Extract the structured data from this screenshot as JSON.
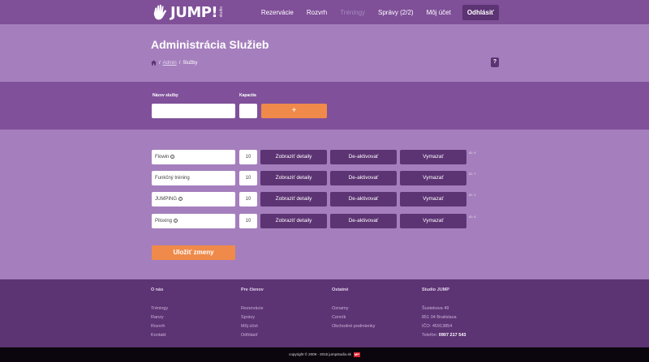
{
  "logo": {
    "text": "JUMP!",
    "sub": "studio"
  },
  "nav": {
    "items": [
      {
        "label": "Rezervácie",
        "active": false
      },
      {
        "label": "Rozvrh",
        "active": false
      },
      {
        "label": "Tréningy",
        "active": true
      },
      {
        "label": "Správy (2/2)",
        "active": false
      },
      {
        "label": "Môj účet",
        "active": false
      }
    ],
    "logout": "Odhlásiť"
  },
  "header": {
    "title": "Administrácia Služieb",
    "breadcrumb": {
      "sep": "/",
      "admin": "Admin",
      "current": "Služby"
    },
    "help": "?"
  },
  "new_service": {
    "name_label": "Názov služby",
    "capacity_label": "Kapacita",
    "add_label": "+"
  },
  "services": [
    {
      "name": "Flowin",
      "info": true,
      "capacity": "10",
      "details": "Zobraziť detaily",
      "deactivate": "De-aktivovať",
      "delete": "Vymazať",
      "id": "ID: 9"
    },
    {
      "name": "Funkčný tréning",
      "info": false,
      "capacity": "10",
      "details": "Zobraziť detaily",
      "deactivate": "De-aktivovať",
      "delete": "Vymazať",
      "id": "ID: 7"
    },
    {
      "name": "JUMPING",
      "info": true,
      "capacity": "10",
      "details": "Zobraziť detaily",
      "deactivate": "De-aktivovať",
      "delete": "Vymazať",
      "id": "ID: 1"
    },
    {
      "name": "Piloxing",
      "info": true,
      "capacity": "10",
      "details": "Zobraziť detaily",
      "deactivate": "De-aktivovať",
      "delete": "Vymazať",
      "id": "ID: 8"
    }
  ],
  "save_label": "Uložiť zmeny",
  "footer": {
    "col1": {
      "title": "O nás",
      "items": [
        "Tréningy",
        "Ranzy",
        "Rozvrh",
        "Kontakt"
      ]
    },
    "col2": {
      "title": "Pre členov",
      "items": [
        "Rezervácie",
        "Správy",
        "Môj účet",
        "Odhlásiť"
      ]
    },
    "col3": {
      "title": "Ostatné",
      "items": [
        "Oznamy",
        "Cenník",
        "Obchodné podmienky"
      ]
    },
    "col4": {
      "title": "Studio JUMP",
      "items": [
        "Šustekova 49",
        "851 04 Bratislava",
        "IČO: 45913854"
      ],
      "phone_label": "Telefón:",
      "phone": "0907 217 543"
    },
    "copyright": "copyright © 2009 - 2015 jumpstudio.sk",
    "badge": "MP"
  },
  "colors": {
    "nav": "#7f4f98",
    "header": "#a57fbd",
    "band": "#80519a",
    "button": "#5c3373",
    "accent": "#ef8a4a",
    "footer": "#5c3373"
  },
  "icons": [
    "hand-logo-icon",
    "home-icon",
    "info-icon"
  ]
}
